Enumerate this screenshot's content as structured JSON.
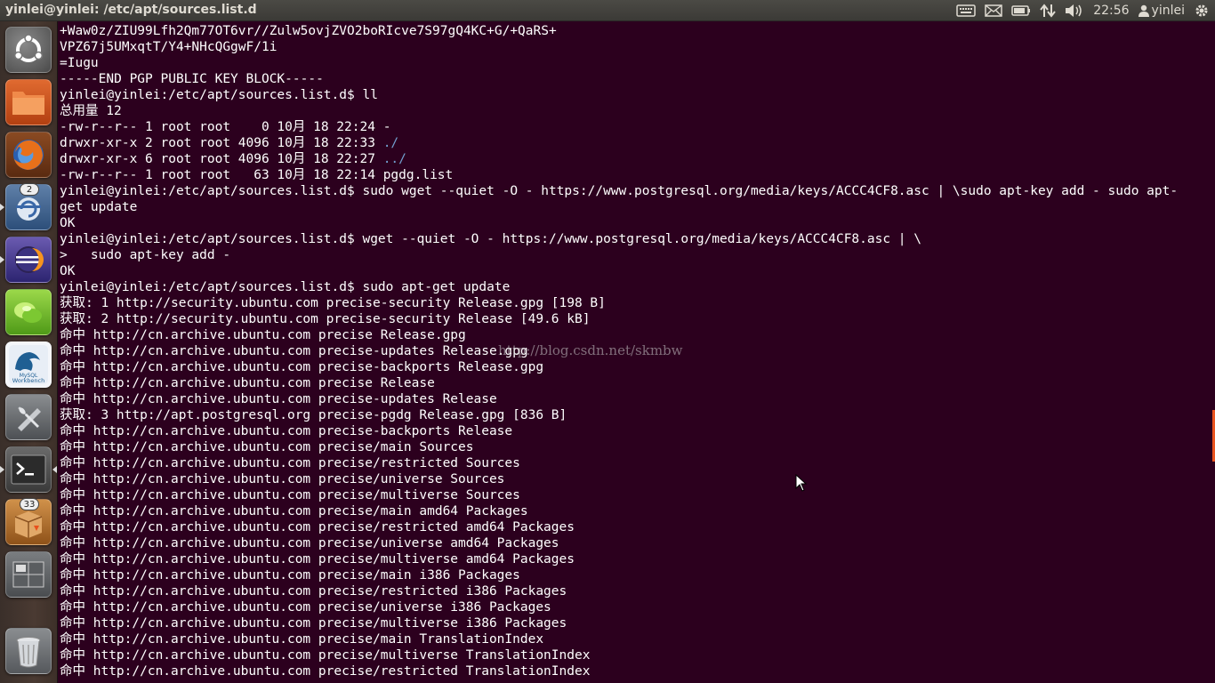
{
  "window": {
    "title": "yinlei@yinlei: /etc/apt/sources.list.d"
  },
  "panel": {
    "indicators": [
      {
        "icon": "keyboard-icon"
      },
      {
        "icon": "mail-icon"
      },
      {
        "icon": "battery-icon"
      },
      {
        "icon": "network-icon"
      },
      {
        "icon": "volume-icon"
      }
    ],
    "clock": "22:56",
    "user": "yinlei",
    "session_icon": "gear-power-icon"
  },
  "launcher": {
    "items": [
      {
        "name": "dash-home",
        "icon": "ubuntu-logo-icon"
      },
      {
        "name": "files",
        "icon": "folder-icon"
      },
      {
        "name": "firefox",
        "icon": "firefox-icon"
      },
      {
        "name": "update-manager",
        "icon": "update-icon",
        "badge": "2"
      },
      {
        "name": "eclipse",
        "icon": "eclipse-icon"
      },
      {
        "name": "app-green",
        "icon": "green-leaf-icon"
      },
      {
        "name": "mysql-workbench",
        "icon": "mysql-workbench-icon",
        "label": "MySQL Workbench"
      },
      {
        "name": "system-settings",
        "icon": "settings-tools-icon"
      },
      {
        "name": "terminal",
        "icon": "terminal-icon"
      },
      {
        "name": "software-updater",
        "icon": "package-icon",
        "badge": "33"
      },
      {
        "name": "workspace-switcher",
        "icon": "workspace-icon"
      },
      {
        "name": "trash",
        "icon": "trash-icon"
      }
    ]
  },
  "terminal": {
    "lines": [
      "+Waw0z/ZIU99Lfh2Qm77OT6vr//Zulw5ovjZVO2boRIcve7S97gQ4KC+G/+QaRS+",
      "VPZ67j5UMxqtT/Y4+NHcQGgwF/1i",
      "=Iugu",
      "-----END PGP PUBLIC KEY BLOCK-----",
      "yinlei@yinlei:/etc/apt/sources.list.d$ ll",
      "总用量 12",
      "-rw-r--r-- 1 root root    0 10月 18 22:24 -",
      "drwxr-xr-x 2 root root 4096 10月 18 22:33 ./",
      "drwxr-xr-x 6 root root 4096 10月 18 22:27 ../",
      "-rw-r--r-- 1 root root   63 10月 18 22:14 pgdg.list",
      "yinlei@yinlei:/etc/apt/sources.list.d$ sudo wget --quiet -O - https://www.postgresql.org/media/keys/ACCC4CF8.asc | \\sudo apt-key add - sudo apt-",
      "get update",
      "OK",
      "yinlei@yinlei:/etc/apt/sources.list.d$ wget --quiet -O - https://www.postgresql.org/media/keys/ACCC4CF8.asc | \\",
      ">   sudo apt-key add -",
      "OK",
      "yinlei@yinlei:/etc/apt/sources.list.d$ sudo apt-get update",
      "获取: 1 http://security.ubuntu.com precise-security Release.gpg [198 B]",
      "获取: 2 http://security.ubuntu.com precise-security Release [49.6 kB]",
      "命中 http://cn.archive.ubuntu.com precise Release.gpg",
      "命中 http://cn.archive.ubuntu.com precise-updates Release.gpg",
      "命中 http://cn.archive.ubuntu.com precise-backports Release.gpg",
      "命中 http://cn.archive.ubuntu.com precise Release",
      "命中 http://cn.archive.ubuntu.com precise-updates Release",
      "获取: 3 http://apt.postgresql.org precise-pgdg Release.gpg [836 B]",
      "命中 http://cn.archive.ubuntu.com precise-backports Release",
      "命中 http://cn.archive.ubuntu.com precise/main Sources",
      "命中 http://cn.archive.ubuntu.com precise/restricted Sources",
      "命中 http://cn.archive.ubuntu.com precise/universe Sources",
      "命中 http://cn.archive.ubuntu.com precise/multiverse Sources",
      "命中 http://cn.archive.ubuntu.com precise/main amd64 Packages",
      "命中 http://cn.archive.ubuntu.com precise/restricted amd64 Packages",
      "命中 http://cn.archive.ubuntu.com precise/universe amd64 Packages",
      "命中 http://cn.archive.ubuntu.com precise/multiverse amd64 Packages",
      "命中 http://cn.archive.ubuntu.com precise/main i386 Packages",
      "命中 http://cn.archive.ubuntu.com precise/restricted i386 Packages",
      "命中 http://cn.archive.ubuntu.com precise/universe i386 Packages",
      "命中 http://cn.archive.ubuntu.com precise/multiverse i386 Packages",
      "命中 http://cn.archive.ubuntu.com precise/main TranslationIndex",
      "命中 http://cn.archive.ubuntu.com precise/multiverse TranslationIndex",
      "命中 http://cn.archive.ubuntu.com precise/restricted TranslationIndex"
    ],
    "watermark": "http://blog.csdn.net/skmbw",
    "background": "#2c001e",
    "foreground": "#ffffff",
    "directory_color": "#729fcf"
  }
}
